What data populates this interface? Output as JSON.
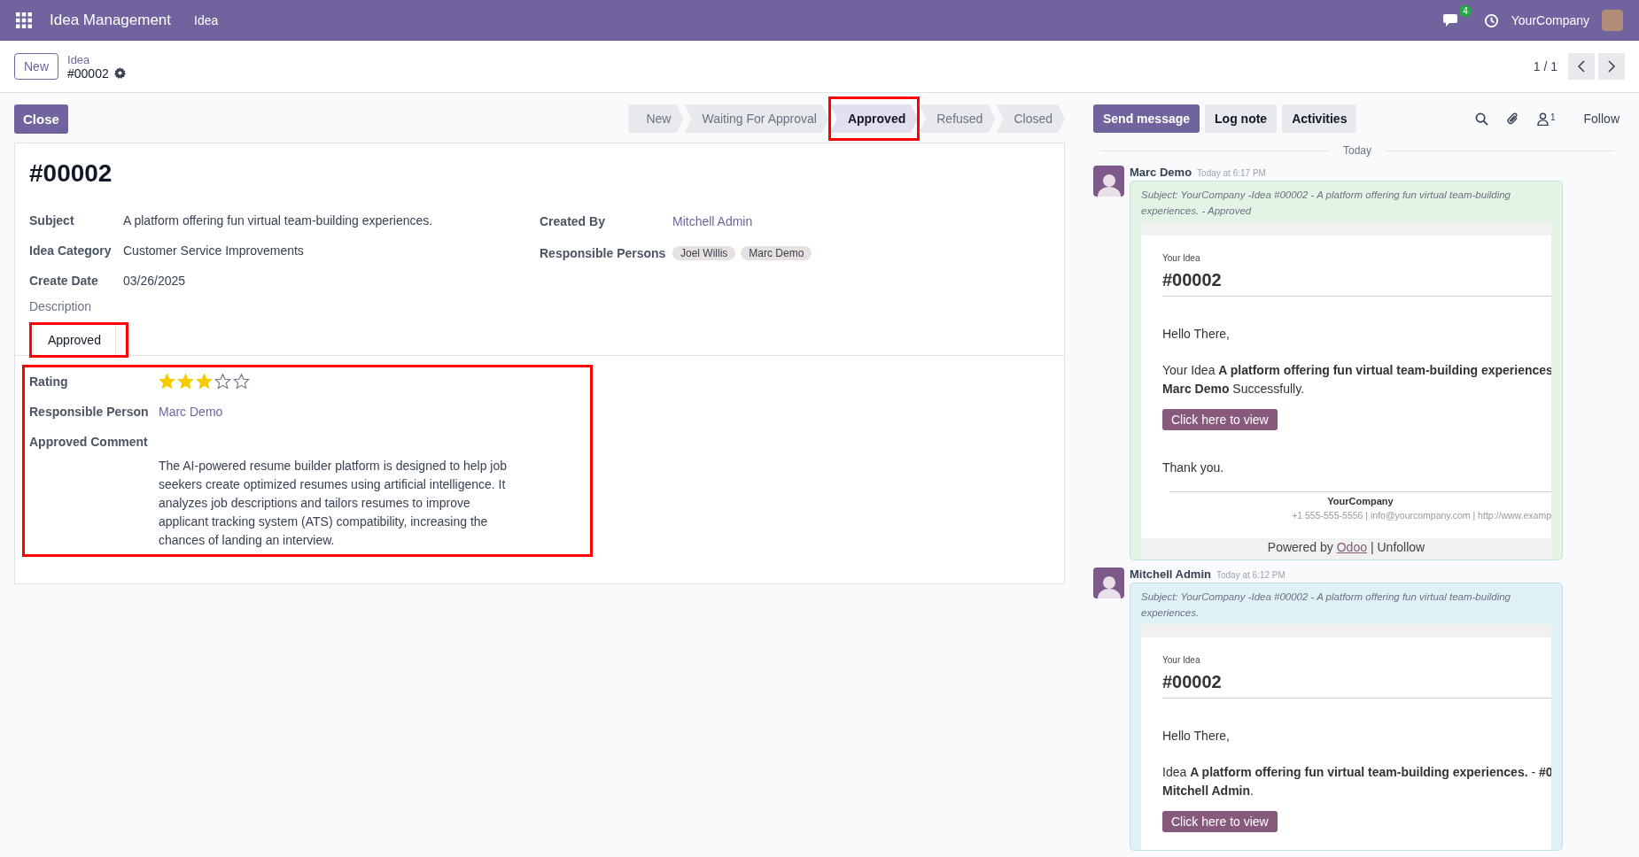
{
  "navbar": {
    "app_name": "Idea Management",
    "menu": [
      "Idea"
    ],
    "chat_badge": "4",
    "company": "YourCompany"
  },
  "breadcrumb": {
    "new_button": "New",
    "parent": "Idea",
    "record": "#00002",
    "pager": "1 / 1"
  },
  "actions": {
    "close_button": "Close"
  },
  "statusbar": [
    {
      "label": "New",
      "selected": false
    },
    {
      "label": "Waiting For Approval",
      "selected": false
    },
    {
      "label": "Approved",
      "selected": true
    },
    {
      "label": "Refused",
      "selected": false
    },
    {
      "label": "Closed",
      "selected": false
    }
  ],
  "form": {
    "title": "#00002",
    "left_fields": [
      {
        "label": "Subject",
        "value": "A platform offering fun virtual team-building experiences."
      },
      {
        "label": "Idea Category",
        "value": "Customer Service Improvements"
      },
      {
        "label": "Create Date",
        "value": "03/26/2025"
      }
    ],
    "right_fields": [
      {
        "label": "Created By",
        "kind": "link",
        "value": "Mitchell Admin"
      },
      {
        "label": "Responsible Persons",
        "kind": "tags",
        "tags": [
          "Joel Willis",
          "Marc Demo"
        ]
      }
    ],
    "description_label": "Description",
    "tabs": [
      {
        "label": "Approved",
        "selected": true
      }
    ],
    "rating_label": "Rating",
    "stars": 3,
    "responsible_label": "Responsible Person",
    "responsible_value": "Marc Demo",
    "comment_label": "Approved Comment",
    "comment": "The AI-powered resume builder platform is designed to help job seekers create optimized resumes using artificial intelligence. It analyzes job descriptions and tailors resumes to improve applicant tracking system (ATS) compatibility, increasing the chances of landing an interview."
  },
  "chatter": {
    "buttons": [
      {
        "label": "Send message",
        "selected": true
      },
      {
        "label": "Log note",
        "selected": false
      },
      {
        "label": "Activities",
        "selected": false
      }
    ],
    "follower_count": "1",
    "follow": "Follow",
    "date_separator": "Today",
    "messages": [
      {
        "author": "Marc Demo",
        "time": "Today at 6:17 PM",
        "color": "#e3f3e6",
        "subject": "Subject: YourCompany -Idea #00002 - A platform offering fun virtual team-building experiences. - Approved",
        "email": {
          "label": "Your Idea",
          "number": "#00002",
          "greeting": "Hello There,",
          "body_lines": [
            "Your Idea **A platform offering fun virtual team-building experiences**",
            "**Marc Demo** Successfully."
          ],
          "button": "Click here to view",
          "closing": "Thank you.",
          "company": "YourCompany",
          "contact": "+1 555-555-5556 | info@yourcompany.com | http://www.examp",
          "footer_prefix": "Powered by",
          "footer_link": "Odoo",
          "footer_suffix": "| Unfollow"
        }
      },
      {
        "author": "Mitchell Admin",
        "time": "Today at 6:12 PM",
        "color": "#dff1f6",
        "subject": "Subject: YourCompany -Idea #00002 - A platform offering fun virtual team-building experiences.",
        "email": {
          "label": "Your Idea",
          "number": "#00002",
          "greeting": "Hello There,",
          "body_lines": [
            "Idea **A platform offering fun virtual team-building experiences.** - **#0**",
            "**Mitchell Admin**."
          ],
          "button": "Click here to view"
        }
      }
    ]
  }
}
